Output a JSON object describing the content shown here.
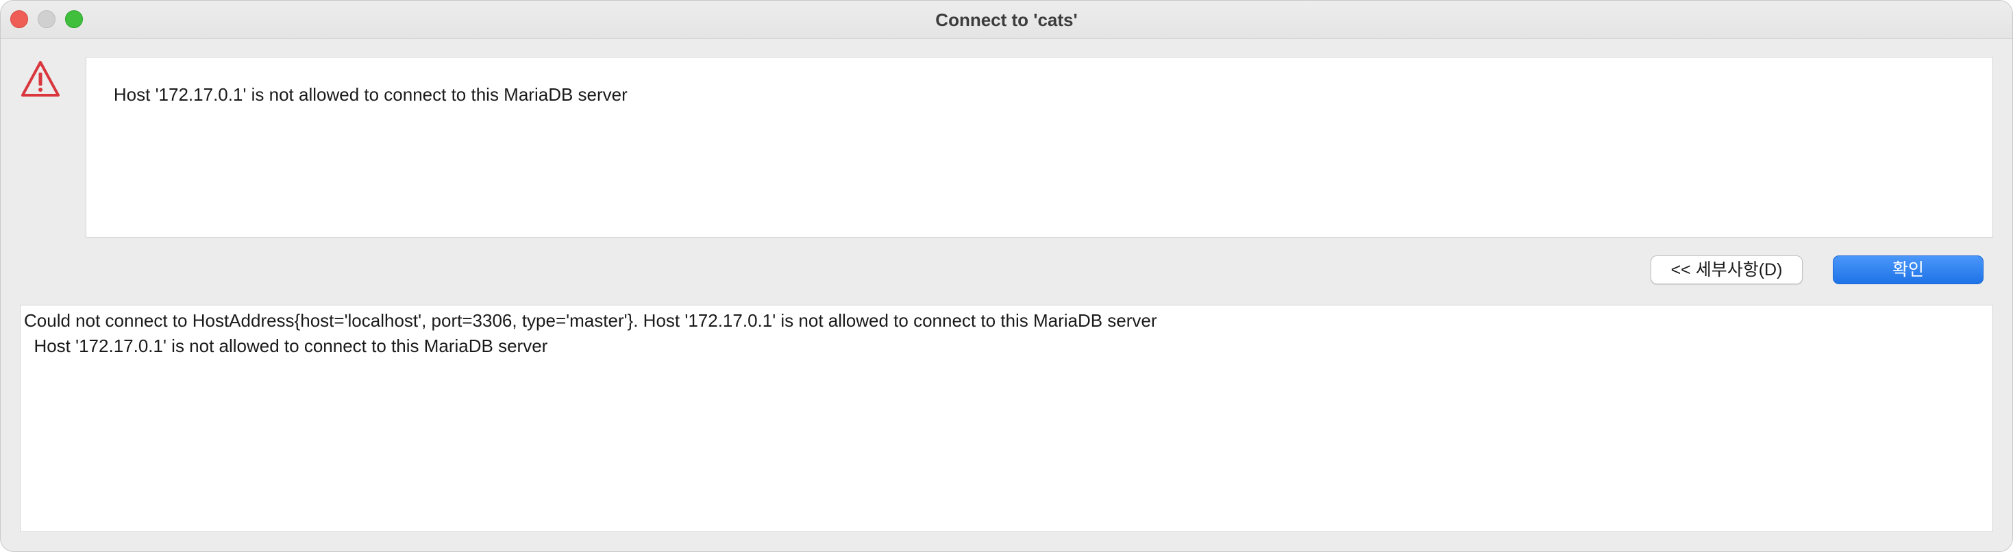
{
  "window": {
    "title": "Connect to 'cats'"
  },
  "icons": {
    "warning": "warning-triangle-icon",
    "warning_color": "#d9363e"
  },
  "message": {
    "text": "Host '172.17.0.1' is not allowed to connect to this MariaDB server"
  },
  "buttons": {
    "details_label": "<< 세부사항(D)",
    "ok_label": "확인",
    "ok_color": "#2a7cf0"
  },
  "details": {
    "lines": [
      "Could not connect to HostAddress{host='localhost', port=3306, type='master'}. Host '172.17.0.1' is not allowed to connect to this MariaDB server",
      "  Host '172.17.0.1' is not allowed to connect to this MariaDB server"
    ]
  }
}
